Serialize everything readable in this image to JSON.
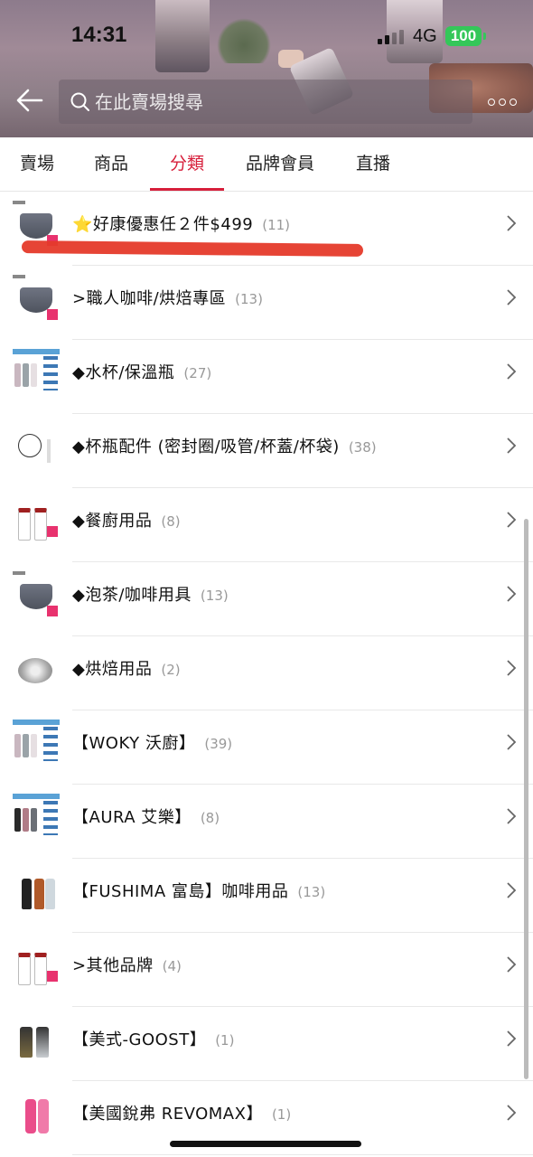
{
  "status": {
    "time": "14:31",
    "network": "4G",
    "battery": "100"
  },
  "header": {
    "search_placeholder": "在此賣場搜尋"
  },
  "tabs": [
    {
      "label": "賣場",
      "active": false
    },
    {
      "label": "商品",
      "active": false
    },
    {
      "label": "分類",
      "active": true
    },
    {
      "label": "品牌會員",
      "active": false
    },
    {
      "label": "直播",
      "active": false
    }
  ],
  "categories": [
    {
      "label": "⭐好康優惠任２件$499",
      "count": "(11)",
      "thumb": "bowl-icon"
    },
    {
      "label": ">職人咖啡/烘焙專區",
      "count": "(13)",
      "thumb": "bowl-icon"
    },
    {
      "label": "◆水杯/保溫瓶",
      "count": "(27)",
      "thumb": "cups-icon"
    },
    {
      "label": "◆杯瓶配件 (密封圈/吸管/杯蓋/杯袋)",
      "count": "(38)",
      "thumb": "ring-icon"
    },
    {
      "label": "◆餐廚用品",
      "count": "(8)",
      "thumb": "jar-icon"
    },
    {
      "label": "◆泡茶/咖啡用具",
      "count": "(13)",
      "thumb": "bowl-icon"
    },
    {
      "label": "◆烘焙用品",
      "count": "(2)",
      "thumb": "pan-icon"
    },
    {
      "label": "【WOKY 沃廚】",
      "count": "(39)",
      "thumb": "cups-icon"
    },
    {
      "label": "【AURA 艾樂】",
      "count": "(8)",
      "thumb": "cups-icon"
    },
    {
      "label": "【FUSHIMA 富島】咖啡用品",
      "count": "(13)",
      "thumb": "coffee-set-icon"
    },
    {
      "label": ">其他品牌",
      "count": "(4)",
      "thumb": "jar-icon"
    },
    {
      "label": "【美式-GOOST】",
      "count": "(1)",
      "thumb": "bottle-icon"
    },
    {
      "label": "【美國銳弗 REVOMAX】",
      "count": "(1)",
      "thumb": "pink-bottle-icon"
    }
  ],
  "colors": {
    "accent": "#d71f3b",
    "highlight": "#e53a2a",
    "battery": "#34c759"
  }
}
